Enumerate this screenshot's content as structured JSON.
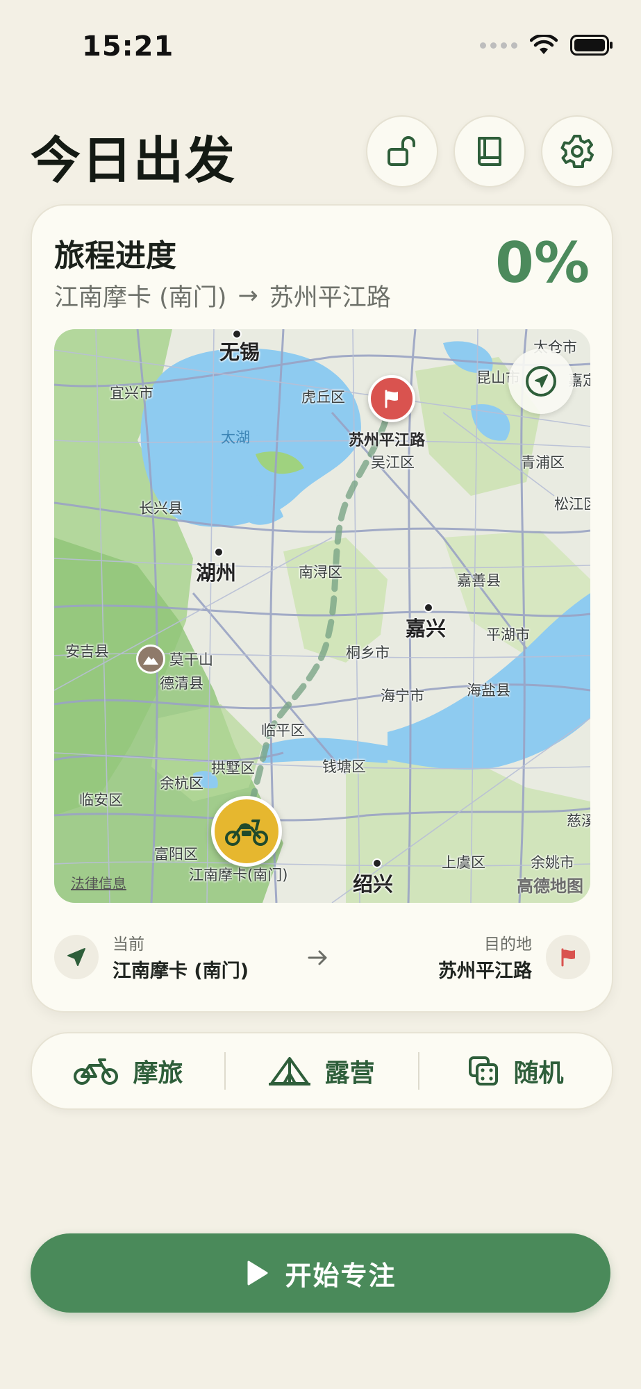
{
  "status_bar": {
    "time": "15:21"
  },
  "header": {
    "title": "今日出发"
  },
  "icons": {
    "unlock": "unlock-icon",
    "book": "book-icon",
    "settings": "gear-icon",
    "locate": "navigation-arrow-icon",
    "flag": "flag-icon",
    "motorcycle": "motorcycle-icon",
    "bicycle": "bicycle-icon",
    "tent": "tent-icon",
    "dice": "dice-icon",
    "play": "play-icon"
  },
  "colors": {
    "accent_green": "#4a8a5a",
    "progress_green": "#4c8a5c",
    "destination_red": "#d9534f",
    "moto_yellow": "#e6b72f",
    "background": "#f3f0e5"
  },
  "journey": {
    "title": "旅程进度",
    "origin": "江南摩卡 (南门)",
    "arrow": "→",
    "destination": "苏州平江路",
    "progress": "0%",
    "progress_fraction": 0
  },
  "map": {
    "labels": {
      "wuxi": "无锡",
      "taicang": "太仓市",
      "yixing": "宜兴市",
      "huqiu": "虎丘区",
      "kunshan": "昆山市",
      "jiading": "嘉定",
      "taihu": "太湖",
      "pingjiang": "苏州平江路",
      "wujiang": "吴江区",
      "qingpu": "青浦区",
      "changxing": "长兴县",
      "songjiang": "松江区",
      "huzhou": "湖州",
      "nanxun": "南浔区",
      "jiashan": "嘉善县",
      "jiaxing": "嘉兴",
      "anji": "安吉县",
      "moganshan": "莫干山",
      "tongxiang": "桐乡市",
      "pinghu": "平湖市",
      "deqing": "德清县",
      "haining": "海宁市",
      "haiyan": "海盐县",
      "linping": "临平区",
      "gongshu": "拱墅区",
      "qiantang": "钱塘区",
      "yuhang": "余杭区",
      "linan": "临安区",
      "cixi": "慈溪",
      "fuyang": "富阳区",
      "origin": "江南摩卡(南门)",
      "shaoxing": "绍兴",
      "shangyu": "上虞区",
      "yuyao": "余姚市"
    },
    "legal": "法律信息",
    "brand": "高德地图"
  },
  "route_summary": {
    "current_caption": "当前",
    "current_value": "江南摩卡 (南门)",
    "destination_caption": "目的地",
    "destination_value": "苏州平江路"
  },
  "modes": [
    {
      "label": "摩旅"
    },
    {
      "label": "露营"
    },
    {
      "label": "随机"
    }
  ],
  "start_button": {
    "label": "开始专注"
  }
}
